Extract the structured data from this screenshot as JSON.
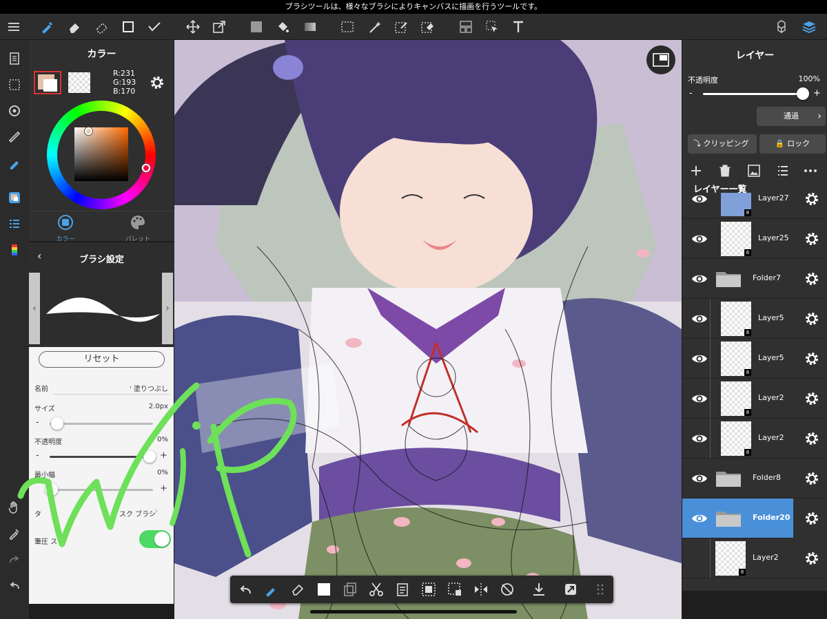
{
  "status_bar": {
    "message": "ブラシツールは、様々なブラシによりキャンバスに描画を行うツールです。"
  },
  "toolbar": {
    "items": [
      "menu-icon",
      "brush-icon",
      "eraser-icon",
      "dotted-eraser-icon",
      "rectangle-icon",
      "select-pen-icon",
      "move-icon",
      "transform-icon",
      "fill-color-icon",
      "bucket-icon",
      "gradient-icon",
      "select-rect-icon",
      "magic-wand-icon",
      "select-pen-dotted-icon",
      "select-erase-icon",
      "layout-icon",
      "operation-icon",
      "text-icon",
      "materials-icon",
      "layers-icon"
    ]
  },
  "color_panel": {
    "title": "カラー",
    "rgb_r": "R:231",
    "rgb_g": "G:193",
    "rgb_b": "B:170",
    "current_color": "#e7c1aa",
    "tab_color": "カラー",
    "tab_palette": "パレット"
  },
  "brush_panel": {
    "title": "ブラシ設定",
    "reset_label": "リセット",
    "name_label": "名前",
    "name_value": "' 塗りつぶし",
    "size_label": "サイズ",
    "size_value": "2.0px",
    "opacity_label": "不透明度",
    "opacity_value": "0%",
    "min_width_label": "最小幅",
    "min_width_value": "0%",
    "type_label": "タ",
    "type_value": "スク ブラシ",
    "pressure_label": "筆圧 ス"
  },
  "layer_panel": {
    "title": "レイヤー",
    "opacity_label": "不透明度",
    "opacity_value": "100%",
    "blend_mode": "通過",
    "clipping_label": "クリッピング",
    "lock_label": "ロック",
    "list_title": "レイヤー一覧",
    "layers": [
      {
        "name": "Layer27",
        "type": "layer",
        "badge": "8"
      },
      {
        "name": "Layer25",
        "type": "layer",
        "badge": "6"
      },
      {
        "name": "Folder7",
        "type": "folder",
        "badge": ""
      },
      {
        "name": "Layer5",
        "type": "layer",
        "badge": "8"
      },
      {
        "name": "Layer5",
        "type": "layer",
        "badge": "8"
      },
      {
        "name": "Layer2",
        "type": "layer",
        "badge": "8"
      },
      {
        "name": "Layer2",
        "type": "layer",
        "badge": "8"
      },
      {
        "name": "Folder8",
        "type": "folder",
        "badge": ""
      },
      {
        "name": "Folder20",
        "type": "folder",
        "badge": "",
        "selected": true
      },
      {
        "name": "Layer2",
        "type": "layer",
        "badge": "8"
      }
    ]
  },
  "bottom_toolbar": {
    "items": [
      "undo-icon",
      "brush-select-icon",
      "eraser-select-icon",
      "fill-square-icon",
      "copy-icon",
      "cut-icon",
      "paste-icon",
      "select-all-icon",
      "deselect-icon",
      "flip-icon",
      "rotate-icon",
      "download-icon",
      "transform-icon",
      "grid-icon"
    ]
  },
  "colors": {
    "accent": "#4a90d9",
    "toggle_on": "#4cd964",
    "wip_stroke": "#6ee05a"
  }
}
